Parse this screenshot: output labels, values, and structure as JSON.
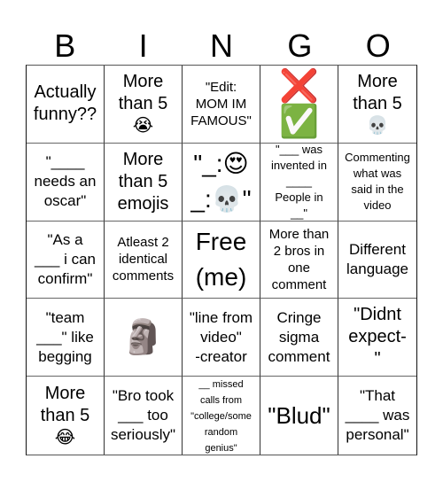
{
  "header": {
    "letters": [
      "B",
      "I",
      "N",
      "G",
      "O"
    ]
  },
  "cells": [
    {
      "text": "Actually\nfunny??",
      "emoji": ""
    },
    {
      "text": "More\nthan 5",
      "emoji": "😭"
    },
    {
      "text": "\"Edit:\nMOM IM\nFAMOUS\"",
      "emoji": ""
    },
    {
      "text": "",
      "emoji": "❌\n✅"
    },
    {
      "text": "More\nthan 5",
      "emoji": "💀"
    },
    {
      "text": "\"____\nneeds an\noscar\"",
      "emoji": ""
    },
    {
      "text": "More\nthan 5\nemojis",
      "emoji": ""
    },
    {
      "text": "\"_:😍\n_:💀\"",
      "emoji": ""
    },
    {
      "text": "\"___ was\ninvented in\n____\nPeople in\n__\"",
      "emoji": ""
    },
    {
      "text": "Commenting\nwhat was\nsaid in the\nvideo",
      "emoji": ""
    },
    {
      "text": "\"As a\n___ i can\nconfirm\"",
      "emoji": ""
    },
    {
      "text": "Atleast 2\nidentical\ncomments",
      "emoji": ""
    },
    {
      "text": "Free\n(me)",
      "emoji": ""
    },
    {
      "text": "More than\n2 bros in\none\ncomment",
      "emoji": ""
    },
    {
      "text": "Different\nlanguage",
      "emoji": ""
    },
    {
      "text": "\"team\n___\" like\nbegging",
      "emoji": ""
    },
    {
      "text": "",
      "emoji": "🗿"
    },
    {
      "text": "\"line from\nvideo\"\n-creator",
      "emoji": ""
    },
    {
      "text": "Cringe\nsigma\ncomment",
      "emoji": ""
    },
    {
      "text": "\"Didnt\nexpect-\n\"",
      "emoji": ""
    },
    {
      "text": "More\nthan 5",
      "emoji": "😂"
    },
    {
      "text": "\"Bro took\n___ too\nseriously\"",
      "emoji": ""
    },
    {
      "text": "__ missed\ncalls from\n\"college/some\nrandom\ngenius\"",
      "emoji": ""
    },
    {
      "text": "\"Blud\"",
      "emoji": ""
    },
    {
      "text": "\"That\n____ was\npersonal\"",
      "emoji": ""
    }
  ]
}
